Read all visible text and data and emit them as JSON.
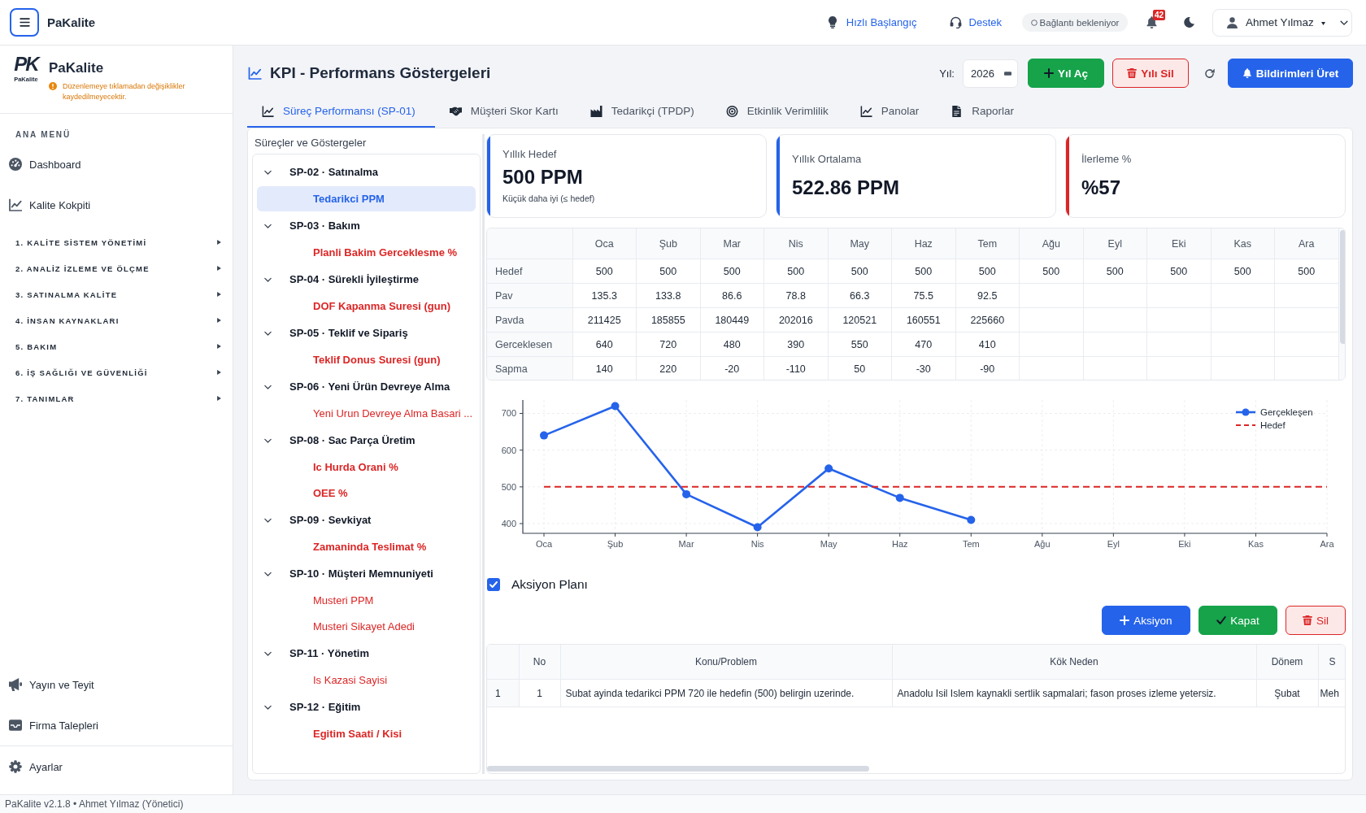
{
  "top_bar": {
    "title": "PaKalite",
    "links": [
      {
        "label": "Hızlı Başlangıç",
        "kind": "quickstart"
      },
      {
        "label": "Destek",
        "kind": "support"
      }
    ],
    "connection_status": "Bağlantı bekleniyor",
    "notification_count": "42",
    "user_name": "Ahmet Yılmaz"
  },
  "sidebar": {
    "logo_mark": "PK",
    "logo_caption": "PaKalite",
    "brand": "PaKalite",
    "warning": "Düzenlemeye tıklamadan değişiklikler kaydedilmeyecektir.",
    "menu_heading": "ANA MENÜ",
    "items": [
      {
        "label": "Dashboard",
        "kind": "dashboard"
      },
      {
        "label": "Kalite Kokpiti",
        "kind": "cockpit"
      }
    ],
    "sections": [
      {
        "label": "1. KALİTE SİSTEM YÖNETİMİ",
        "expanded": false
      },
      {
        "label": "2. ANALİZ İZLEME VE ÖLÇME",
        "expanded": false
      },
      {
        "label": "3. SATINALMA KALİTE",
        "expanded": false
      },
      {
        "label": "4. İNSAN KAYNAKLARI",
        "expanded": false
      },
      {
        "label": "5. BAKIM",
        "expanded": false
      },
      {
        "label": "6. İŞ SAĞLIĞI VE GÜVENLİĞİ",
        "expanded": false
      },
      {
        "label": "7. TANIMLAR",
        "expanded": false
      }
    ],
    "bottom_items": [
      {
        "label": "Yayın ve Teyit",
        "kind": "broadcast"
      },
      {
        "label": "Firma Talepleri",
        "kind": "requests"
      },
      {
        "label": "Ayarlar",
        "kind": "settings"
      }
    ]
  },
  "header": {
    "title": "KPI - Performans Göstergeleri",
    "year_label": "Yıl:",
    "year": "2026",
    "buttons": [
      {
        "label": "Yıl Aç",
        "kind": "add"
      },
      {
        "label": "Yılı Sil",
        "kind": "delete"
      },
      {
        "label": "Bildirimleri Üret",
        "kind": "notify"
      }
    ]
  },
  "tabs": [
    {
      "label": "Süreç Performansı (SP-01)",
      "kind": "process",
      "selected": true
    },
    {
      "label": "Müşteri Skor Kartı",
      "kind": "customer",
      "selected": false
    },
    {
      "label": "Tedarikçi (TPDP)",
      "kind": "supplier",
      "selected": false
    },
    {
      "label": "Etkinlik Verimlilik",
      "kind": "efficiency",
      "selected": false
    },
    {
      "label": "Panolar",
      "kind": "dashboards",
      "selected": false
    },
    {
      "label": "Raporlar",
      "kind": "reports",
      "selected": false
    }
  ],
  "tree": {
    "title": "Süreçler ve Göstergeler",
    "groups": [
      {
        "label": "SP-02 · Satınalma",
        "expanded": true,
        "children": [
          {
            "label": "Tedarikci PPM",
            "selected": true,
            "emphasized": true
          }
        ]
      },
      {
        "label": "SP-03 · Bakım",
        "expanded": true,
        "children": [
          {
            "label": "Planli Bakim Gerceklesme %",
            "selected": false,
            "emphasized": true
          }
        ]
      },
      {
        "label": "SP-04 · Sürekli İyileştirme",
        "expanded": true,
        "children": [
          {
            "label": "DOF Kapanma Suresi (gun)",
            "selected": false,
            "emphasized": true
          }
        ]
      },
      {
        "label": "SP-05 · Teklif ve Sipariş",
        "expanded": true,
        "children": [
          {
            "label": "Teklif Donus Suresi (gun)",
            "selected": false,
            "emphasized": true
          }
        ]
      },
      {
        "label": "SP-06 · Yeni Ürün Devreye Alma",
        "expanded": true,
        "children": [
          {
            "label": "Yeni Urun Devreye Alma Basari ...",
            "selected": false,
            "emphasized": false
          }
        ]
      },
      {
        "label": "SP-08 · Sac Parça Üretim",
        "expanded": true,
        "children": [
          {
            "label": "Ic Hurda Orani %",
            "selected": false,
            "emphasized": true
          },
          {
            "label": "OEE %",
            "selected": false,
            "emphasized": true
          }
        ]
      },
      {
        "label": "SP-09 · Sevkiyat",
        "expanded": true,
        "children": [
          {
            "label": "Zamaninda Teslimat %",
            "selected": false,
            "emphasized": true
          }
        ]
      },
      {
        "label": "SP-10 · Müşteri Memnuniyeti",
        "expanded": true,
        "children": [
          {
            "label": "Musteri PPM",
            "selected": false,
            "emphasized": false
          },
          {
            "label": "Musteri Sikayet Adedi",
            "selected": false,
            "emphasized": false
          }
        ]
      },
      {
        "label": "SP-11 · Yönetim",
        "expanded": true,
        "children": [
          {
            "label": "Is Kazasi Sayisi",
            "selected": false,
            "emphasized": false
          }
        ]
      },
      {
        "label": "SP-12 · Eğitim",
        "expanded": true,
        "children": [
          {
            "label": "Egitim Saati / Kisi",
            "selected": false,
            "emphasized": true
          }
        ]
      }
    ]
  },
  "kpi_cards": [
    {
      "label": "Yıllık Hedef",
      "value": "500 PPM",
      "note": "Küçük daha iyi (≤ hedef)",
      "color": "#2563eb"
    },
    {
      "label": "Yıllık Ortalama",
      "value": "522.86 PPM",
      "color": "#2563eb"
    },
    {
      "label": "İlerleme %",
      "value": "%57",
      "color": "#dc2626"
    }
  ],
  "kpi_table": {
    "columns": [
      "Oca",
      "Şub",
      "Mar",
      "Nis",
      "May",
      "Haz",
      "Tem",
      "Ağu",
      "Eyl",
      "Eki",
      "Kas",
      "Ara"
    ],
    "rows": [
      {
        "label": "Hedef",
        "cells": [
          "500",
          "500",
          "500",
          "500",
          "500",
          "500",
          "500",
          "500",
          "500",
          "500",
          "500",
          "500"
        ]
      },
      {
        "label": "Pav",
        "cells": [
          "135.3",
          "133.8",
          "86.6",
          "78.8",
          "66.3",
          "75.5",
          "92.5"
        ]
      },
      {
        "label": "Pavda",
        "cells": [
          "211425",
          "185855",
          "180449",
          "202016",
          "120521",
          "160551",
          "225660"
        ]
      },
      {
        "label": "Gerceklesen",
        "cells": [
          "640",
          "720",
          "480",
          "390",
          "550",
          "470",
          "410"
        ]
      },
      {
        "label": "Sapma",
        "cells": [
          "140",
          "220",
          "-20",
          "-110",
          "50",
          "-30",
          "-90"
        ]
      }
    ]
  },
  "trend_chart": {
    "chart_data": {
      "type": "line",
      "categories": [
        "Oca",
        "Şub",
        "Mar",
        "Nis",
        "May",
        "Haz",
        "Tem",
        "Ağu",
        "Eyl",
        "Eki",
        "Kas",
        "Ara"
      ],
      "series": [
        {
          "name": "Gerçekleşen",
          "color": "#2563eb",
          "line_style": "solid",
          "marker": "circle",
          "values": [
            640,
            720,
            480,
            390,
            550,
            470,
            410,
            null,
            null,
            null,
            null,
            null
          ]
        },
        {
          "name": "Hedef",
          "color": "#dc2626",
          "line_style": "dashed",
          "values": [
            500,
            500,
            500,
            500,
            500,
            500,
            500,
            500,
            500,
            500,
            500,
            500
          ]
        }
      ],
      "ylim": [
        373.5,
        736.5
      ],
      "yticks": [
        400,
        500,
        600,
        700
      ],
      "grid": true,
      "legend": true
    }
  },
  "action_plan": {
    "title": "Aksiyon Planı",
    "checked": true,
    "buttons": [
      {
        "label": "Aksiyon",
        "kind": "add"
      },
      {
        "label": "Kapat",
        "kind": "close"
      },
      {
        "label": "Sil",
        "kind": "delete"
      }
    ],
    "columns": [
      "No",
      "Konu/Problem",
      "Kök Neden",
      "Dönem",
      "S"
    ],
    "rows": [
      {
        "row_number": "1",
        "cells": [
          "1",
          "Subat ayinda tedarikci PPM 720 ile hedefin (500) belirgin uzerinde.",
          "Anadolu Isil Islem kaynakli sertlik sapmalari; fason proses izleme yetersiz.",
          "Şubat",
          "Meh"
        ]
      }
    ]
  },
  "status_bar": {
    "text": "PaKalite v2.1.8 • Ahmet Yılmaz (Yönetici)"
  }
}
